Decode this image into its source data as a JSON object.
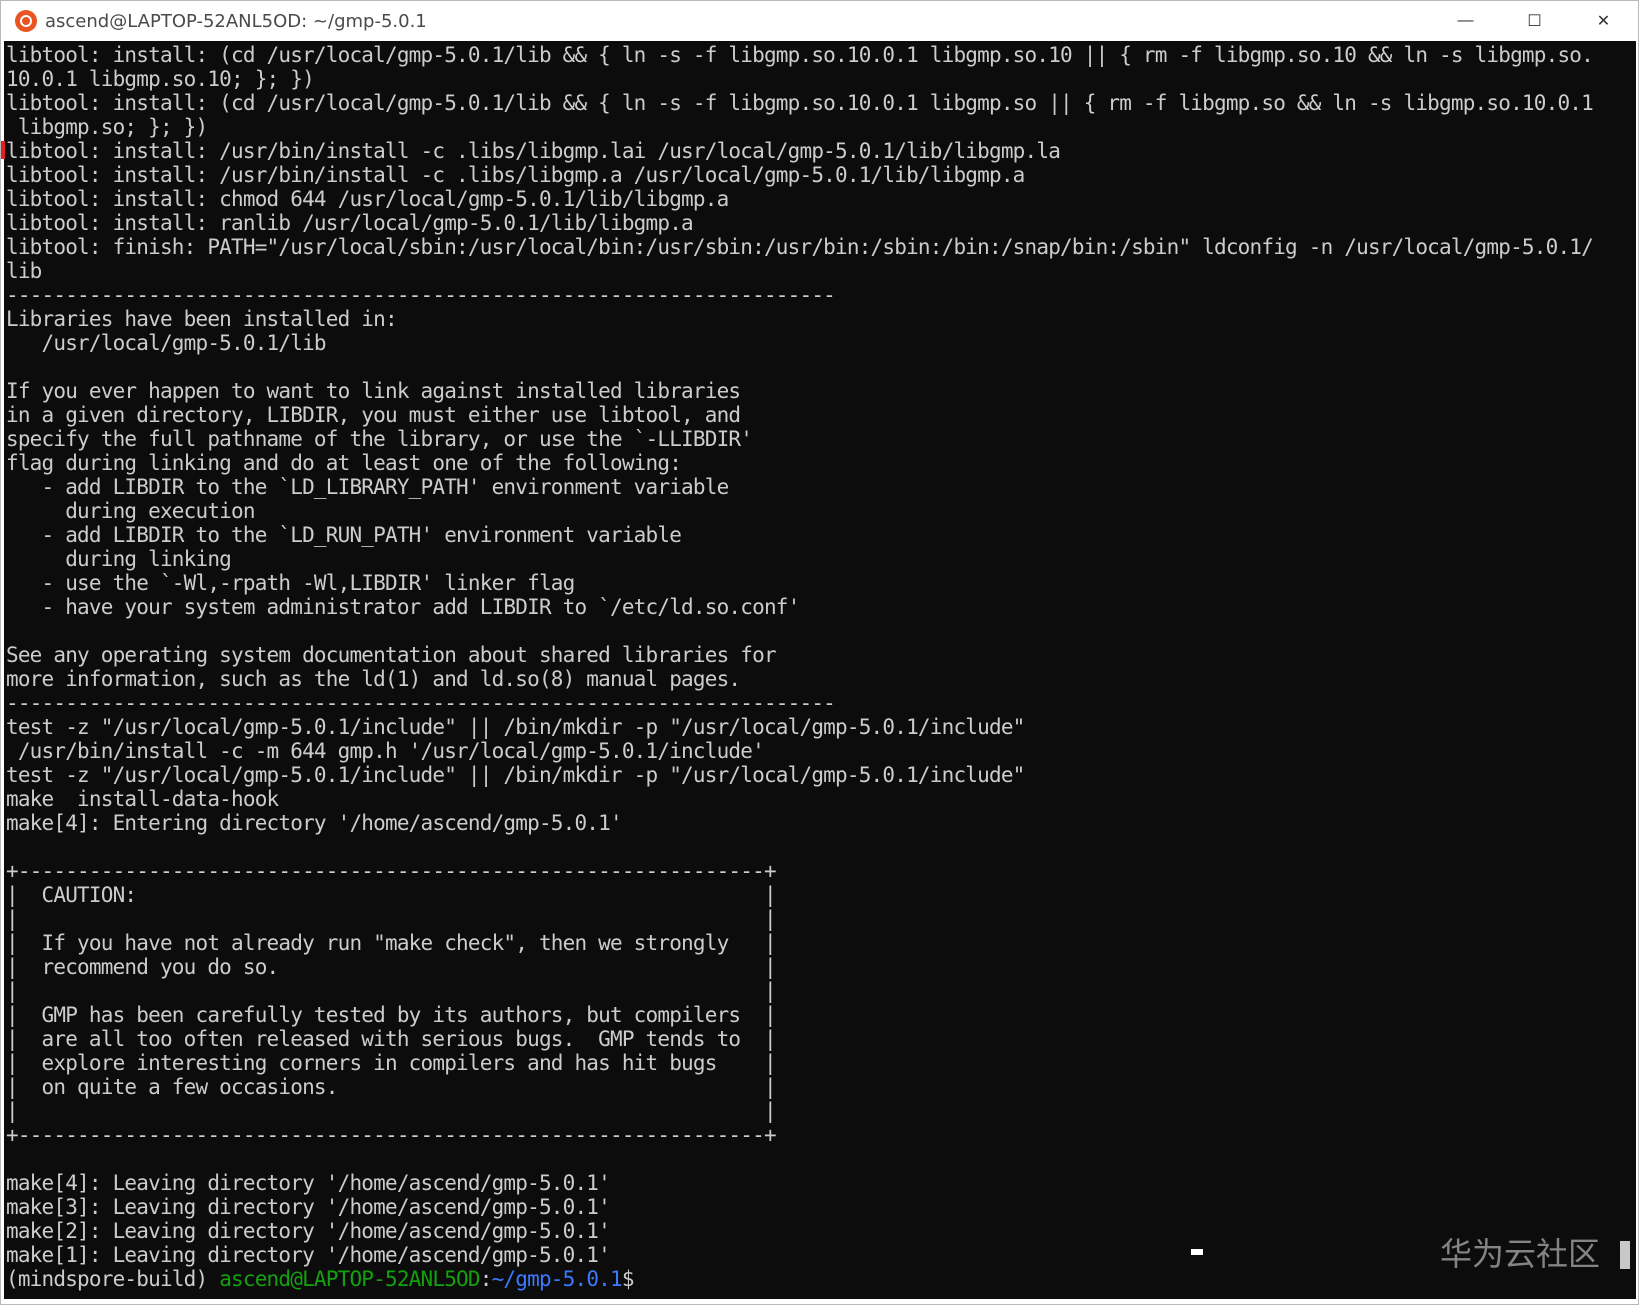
{
  "window": {
    "title": "ascend@LAPTOP-52ANL5OD: ~/gmp-5.0.1",
    "minimize_glyph": "—",
    "maximize_glyph": "☐",
    "close_glyph": "✕",
    "app_icon": "ubuntu-icon"
  },
  "terminal": {
    "lines": [
      "libtool: install: (cd /usr/local/gmp-5.0.1/lib && { ln -s -f libgmp.so.10.0.1 libgmp.so.10 || { rm -f libgmp.so.10 && ln -s libgmp.so.",
      "10.0.1 libgmp.so.10; }; })",
      "libtool: install: (cd /usr/local/gmp-5.0.1/lib && { ln -s -f libgmp.so.10.0.1 libgmp.so || { rm -f libgmp.so && ln -s libgmp.so.10.0.1",
      " libgmp.so; }; })",
      "libtool: install: /usr/bin/install -c .libs/libgmp.lai /usr/local/gmp-5.0.1/lib/libgmp.la",
      "libtool: install: /usr/bin/install -c .libs/libgmp.a /usr/local/gmp-5.0.1/lib/libgmp.a",
      "libtool: install: chmod 644 /usr/local/gmp-5.0.1/lib/libgmp.a",
      "libtool: install: ranlib /usr/local/gmp-5.0.1/lib/libgmp.a",
      "libtool: finish: PATH=\"/usr/local/sbin:/usr/local/bin:/usr/sbin:/usr/bin:/sbin:/bin:/snap/bin:/sbin\" ldconfig -n /usr/local/gmp-5.0.1/",
      "lib",
      "----------------------------------------------------------------------",
      "Libraries have been installed in:",
      "   /usr/local/gmp-5.0.1/lib",
      "",
      "If you ever happen to want to link against installed libraries",
      "in a given directory, LIBDIR, you must either use libtool, and",
      "specify the full pathname of the library, or use the `-LLIBDIR'",
      "flag during linking and do at least one of the following:",
      "   - add LIBDIR to the `LD_LIBRARY_PATH' environment variable",
      "     during execution",
      "   - add LIBDIR to the `LD_RUN_PATH' environment variable",
      "     during linking",
      "   - use the `-Wl,-rpath -Wl,LIBDIR' linker flag",
      "   - have your system administrator add LIBDIR to `/etc/ld.so.conf'",
      "",
      "See any operating system documentation about shared libraries for",
      "more information, such as the ld(1) and ld.so(8) manual pages.",
      "----------------------------------------------------------------------",
      "test -z \"/usr/local/gmp-5.0.1/include\" || /bin/mkdir -p \"/usr/local/gmp-5.0.1/include\"",
      " /usr/bin/install -c -m 644 gmp.h '/usr/local/gmp-5.0.1/include'",
      "test -z \"/usr/local/gmp-5.0.1/include\" || /bin/mkdir -p \"/usr/local/gmp-5.0.1/include\"",
      "make  install-data-hook",
      "make[4]: Entering directory '/home/ascend/gmp-5.0.1'",
      "",
      "+---------------------------------------------------------------+",
      "|  CAUTION:                                                     |",
      "|                                                               |",
      "|  If you have not already run \"make check\", then we strongly   |",
      "|  recommend you do so.                                         |",
      "|                                                               |",
      "|  GMP has been carefully tested by its authors, but compilers  |",
      "|  are all too often released with serious bugs.  GMP tends to  |",
      "|  explore interesting corners in compilers and has hit bugs    |",
      "|  on quite a few occasions.                                    |",
      "|                                                               |",
      "+---------------------------------------------------------------+",
      "",
      "make[4]: Leaving directory '/home/ascend/gmp-5.0.1'",
      "make[3]: Leaving directory '/home/ascend/gmp-5.0.1'",
      "make[2]: Leaving directory '/home/ascend/gmp-5.0.1'",
      "make[1]: Leaving directory '/home/ascend/gmp-5.0.1'"
    ],
    "prompt": {
      "env": "(mindspore-build) ",
      "user_host": "ascend@LAPTOP-52ANL5OD",
      "separator": ":",
      "path": "~/gmp-5.0.1",
      "dollar": "$"
    },
    "colors": {
      "background": "#0c0c0c",
      "foreground": "#cccccc",
      "user_host": "#13a10e",
      "path": "#3b78ff"
    }
  },
  "watermark": "华为云社区"
}
